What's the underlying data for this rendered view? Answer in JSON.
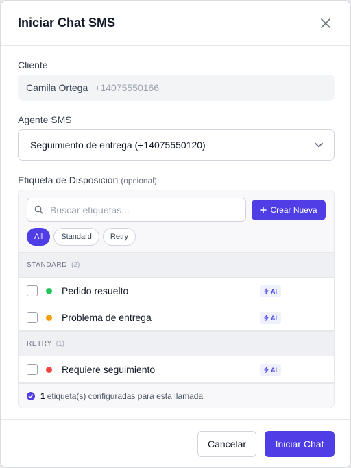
{
  "modal": {
    "title": "Iniciar Chat SMS"
  },
  "client": {
    "label": "Cliente",
    "name": "Camila Ortega",
    "phone": "+14075550166"
  },
  "agent": {
    "label": "Agente SMS",
    "selected": "Seguimiento de entrega (+14075550120)"
  },
  "disposition": {
    "label": "Etiqueta de Disposición",
    "optional": "(opcional)",
    "search_placeholder": "Buscar etiquetas...",
    "create_label": "Crear Nueva",
    "filters": [
      {
        "label": "All",
        "active": true
      },
      {
        "label": "Standard",
        "active": false
      },
      {
        "label": "Retry",
        "active": false
      }
    ],
    "sections": [
      {
        "title": "STANDARD",
        "count": "(2)",
        "items": [
          {
            "label": "Pedido resuelto",
            "dot_color": "#22c55e",
            "badge": "AI"
          },
          {
            "label": "Problema de entrega",
            "dot_color": "#f59e0b",
            "badge": "AI"
          }
        ]
      },
      {
        "title": "RETRY",
        "count": "(1)",
        "items": [
          {
            "label": "Requiere seguimiento",
            "dot_color": "#ef4444",
            "badge": "AI"
          }
        ]
      }
    ],
    "footer_count": "1",
    "footer_text": "etiqueta(s) configuradas para esta llamada"
  },
  "actions": {
    "cancel": "Cancelar",
    "start": "Iniciar Chat"
  },
  "colors": {
    "accent": "#4f3ee6"
  }
}
